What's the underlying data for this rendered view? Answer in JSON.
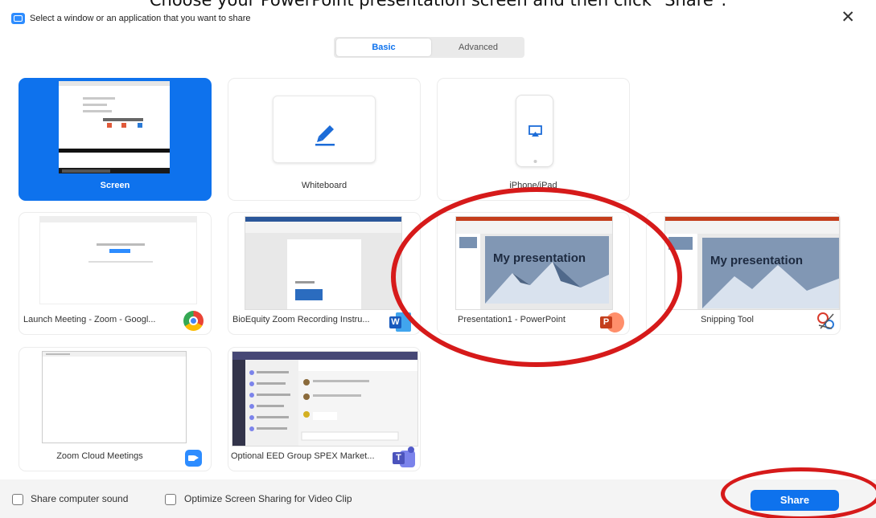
{
  "caption": "Choose your PowerPoint presentation screen and then click \"Share\".",
  "window": {
    "title": "Select a window or an application that you want to share",
    "close_glyph": "✕"
  },
  "tabs": {
    "basic": "Basic",
    "advanced": "Advanced",
    "active": "Basic"
  },
  "tiles": [
    {
      "label": "Screen",
      "selected": true
    },
    {
      "label": "Whiteboard",
      "icon": "pencil-icon"
    },
    {
      "label": "iPhone/iPad",
      "icon": "airplay-icon"
    },
    {
      "label": "Launch Meeting - Zoom - Googl...",
      "app_icon": "chrome-icon"
    },
    {
      "label": "BioEquity Zoom Recording Instru...",
      "app_icon": "word-icon",
      "badge_letter": "W"
    },
    {
      "label": "Presentation1 - PowerPoint",
      "app_icon": "powerpoint-icon",
      "badge_letter": "P",
      "slide_title": "My presentation"
    },
    {
      "label": "Snipping Tool",
      "app_icon": "snipping-tool-icon",
      "slide_title": "My presentation"
    },
    {
      "label": "Zoom Cloud Meetings",
      "app_icon": "zoom-icon"
    },
    {
      "label": "Optional EED Group SPEX Market...",
      "app_icon": "teams-icon",
      "badge_letter": "T"
    }
  ],
  "footer": {
    "share_sound": "Share computer sound",
    "share_sound_checked": false,
    "optimize_video": "Optimize Screen Sharing for Video Clip",
    "optimize_video_checked": false,
    "share_button": "Share"
  },
  "colors": {
    "accent": "#0e72ed",
    "annotation": "#d61a1a",
    "footer_bg": "#f4f4f4"
  }
}
